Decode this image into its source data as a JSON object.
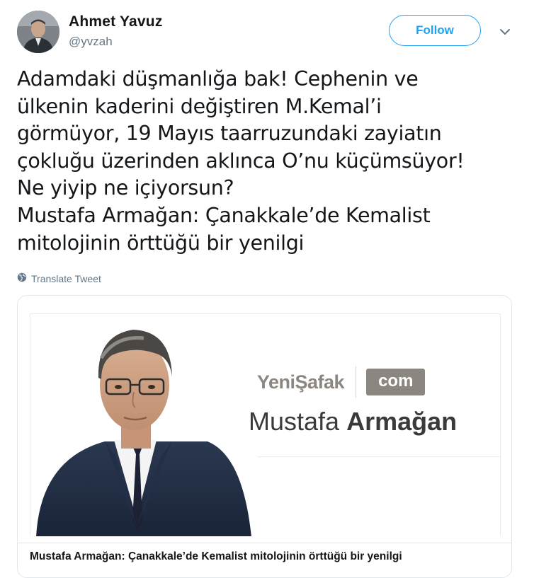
{
  "author": {
    "name": "Ahmet Yavuz",
    "handle": "@yvzah"
  },
  "actions": {
    "follow_label": "Follow",
    "menu_icon": "chevron-down-icon"
  },
  "tweet": {
    "lines": [
      "Adamdaki düşmanlığa bak! Cephenin ve",
      "ülkenin kaderini değiştiren M.Kemal’i",
      "görmüyor, 19 Mayıs taarruzundaki zayiatın",
      "çokluğu üzerinden aklınca O’nu küçümsüyor!",
      "Ne yiyip ne içiyorsun?",
      "Mustafa Armağan: Çanakkale’de Kemalist",
      "mitolojinin örttüğü bir yenilgi"
    ],
    "translate_label": "Translate Tweet"
  },
  "card": {
    "brand_name": "YeniŞafak",
    "brand_badge": "com",
    "author_first": "Mustafa",
    "author_last": "Armağan",
    "title": "Mustafa Armağan: Çanakkale’de Kemalist mitolojinin örttüğü bir yenilgi"
  },
  "colors": {
    "accent": "#1da1f2",
    "text": "#14171a",
    "muted": "#657786",
    "border": "#e1e8ed",
    "brand": "#8c8680"
  }
}
